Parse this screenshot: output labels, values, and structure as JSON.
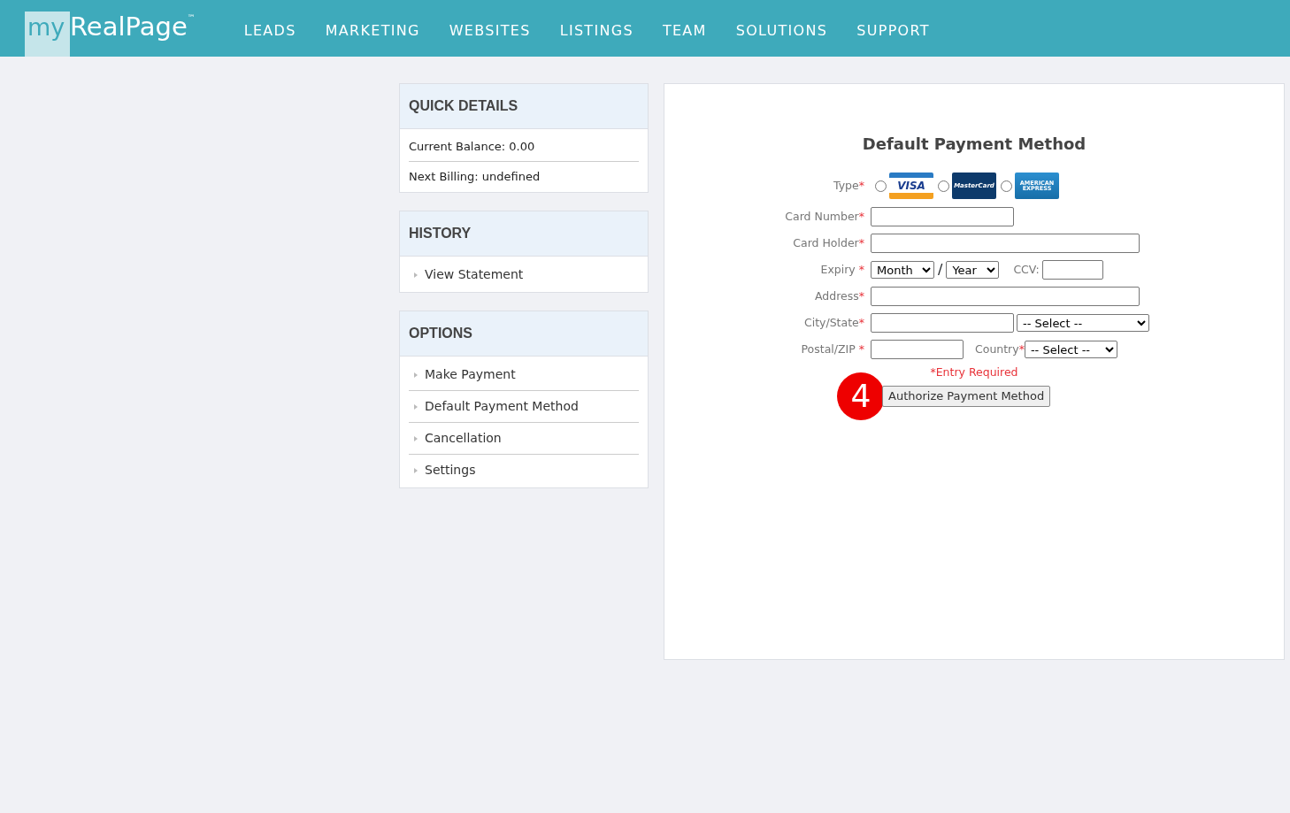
{
  "brand": {
    "prefix": "my",
    "name": "RealPage",
    "trademark": "™"
  },
  "nav": [
    {
      "label": "LEADS"
    },
    {
      "label": "MARKETING"
    },
    {
      "label": "WEBSITES"
    },
    {
      "label": "LISTINGS"
    },
    {
      "label": "TEAM"
    },
    {
      "label": "SOLUTIONS"
    },
    {
      "label": "SUPPORT"
    }
  ],
  "sidebar": [
    {
      "title": "QUICK DETAILS",
      "kind": "info",
      "items": [
        "Current Balance: 0.00",
        "Next Billing: undefined"
      ]
    },
    {
      "title": "HISTORY",
      "kind": "links",
      "items": [
        "View Statement"
      ]
    },
    {
      "title": "OPTIONS",
      "kind": "links",
      "items": [
        "Make Payment",
        "Default Payment Method",
        "Cancellation",
        "Settings"
      ]
    }
  ],
  "form": {
    "title": "Default Payment Method",
    "rows": [
      {
        "kind": "card-type",
        "label": "Type",
        "mark": "*",
        "options": [
          {
            "text": "VISA",
            "selected": false
          },
          {
            "text": "MasterCard",
            "selected": false
          },
          {
            "text": "AMERICAN EXPRESS",
            "selected": false
          }
        ]
      },
      {
        "kind": "short",
        "label": "Card Number",
        "mark": "*"
      },
      {
        "kind": "long",
        "label": "Card Holder",
        "mark": "*"
      },
      {
        "kind": "expiry",
        "label": "Expiry ",
        "mark": "*",
        "month": "Month",
        "separator": "/",
        "year": "Year",
        "ccv_label": "CCV:"
      },
      {
        "kind": "long",
        "label": "Address",
        "mark": "*"
      },
      {
        "kind": "city",
        "label": "City/State",
        "mark": "*",
        "state": "-- Select --"
      },
      {
        "kind": "postal",
        "label": "Postal/ZIP ",
        "mark": "*",
        "country_label": "Country",
        "country_mark": "*",
        "country": "-- Select --"
      }
    ],
    "note": "*Entry Required",
    "step": "4",
    "button": "Authorize Payment Method"
  }
}
